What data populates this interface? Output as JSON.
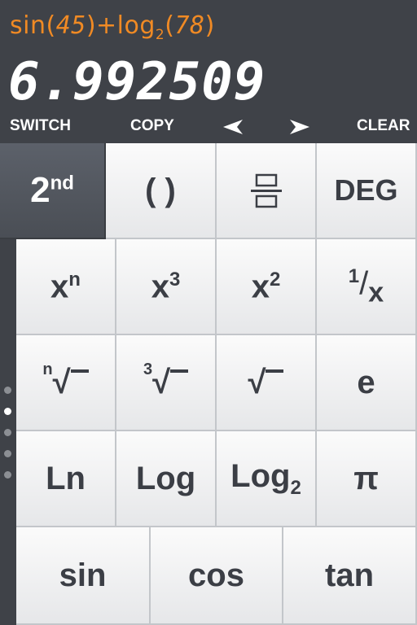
{
  "display": {
    "expression": {
      "prefix": "sin(",
      "arg1": "45",
      "mid": ")+log",
      "sub": "2",
      "open2": "(",
      "arg2": "78",
      "close2": ")"
    },
    "result": "6.992509"
  },
  "toolbar": {
    "switch": "SWITCH",
    "copy": "COPY",
    "clear": "CLEAR",
    "left_icon": "left-arrow-icon",
    "right_icon": "right-arrow-icon"
  },
  "keys": {
    "second": {
      "base": "2",
      "sup": "nd"
    },
    "parens": "( )",
    "fraction_icon": "fraction-icon",
    "deg": "DEG",
    "xn": {
      "base": "x",
      "sup": "n"
    },
    "x3": {
      "base": "x",
      "sup": "3"
    },
    "x2": {
      "base": "x",
      "sup": "2"
    },
    "reciprocal": {
      "num": "1",
      "slash": "/",
      "den": "x"
    },
    "nroot": {
      "index": "n",
      "radical": "√"
    },
    "cuberoot": {
      "index": "3",
      "radical": "√"
    },
    "sqrt": {
      "radical": "√"
    },
    "e": "e",
    "ln": "Ln",
    "log": "Log",
    "log2": {
      "base": "Log",
      "sub": "2"
    },
    "pi": "π",
    "sin": "sin",
    "cos": "cos",
    "tan": "tan"
  },
  "pager": {
    "pages": 5,
    "active": 2
  },
  "colors": {
    "accent": "#f08a24",
    "background": "#3f4248",
    "key": "#f2f2f3",
    "key_text": "#3b3e45",
    "active_key": "#52575f"
  }
}
